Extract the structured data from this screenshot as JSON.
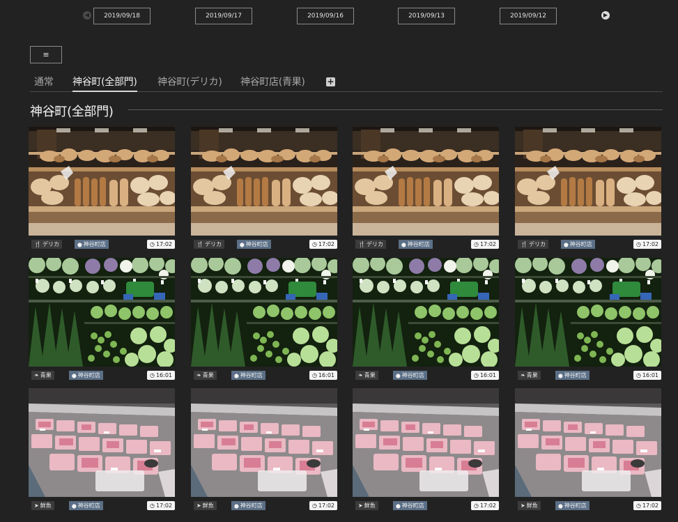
{
  "date_nav": {
    "prev_icon": "chevron-left-circle-icon",
    "next_icon": "chevron-right-circle-icon",
    "dates": [
      "2019/09/18",
      "2019/09/17",
      "2019/09/16",
      "2019/09/13",
      "2019/09/12"
    ]
  },
  "menu_button": {
    "icon": "≡"
  },
  "tabs": [
    {
      "label": "通常",
      "active": false
    },
    {
      "label": "神谷町(全部門)",
      "active": true
    },
    {
      "label": "神谷町(デリカ)",
      "active": false
    },
    {
      "label": "神谷町店(青果)",
      "active": false
    }
  ],
  "add_tab_icon": "+",
  "section": {
    "title": "神谷町(全部門)"
  },
  "photo_rows": [
    {
      "scene": "bakery",
      "category": "デリカ",
      "category_icon": "utensils-icon",
      "store": "神谷町店",
      "time": "17:02"
    },
    {
      "scene": "vegetables",
      "category": "青果",
      "category_icon": "leaf-icon",
      "store": "神谷町店",
      "time": "16:01"
    },
    {
      "scene": "fish",
      "category": "鮮魚",
      "category_icon": "fish-icon",
      "store": "神谷町店",
      "time": "17:02"
    }
  ],
  "cards_per_row": 4,
  "colors": {
    "background": "#222222",
    "store_tag": "#5b6f86",
    "category_tag": "#3b3b3b",
    "time_tag": "#f5f5f5"
  }
}
